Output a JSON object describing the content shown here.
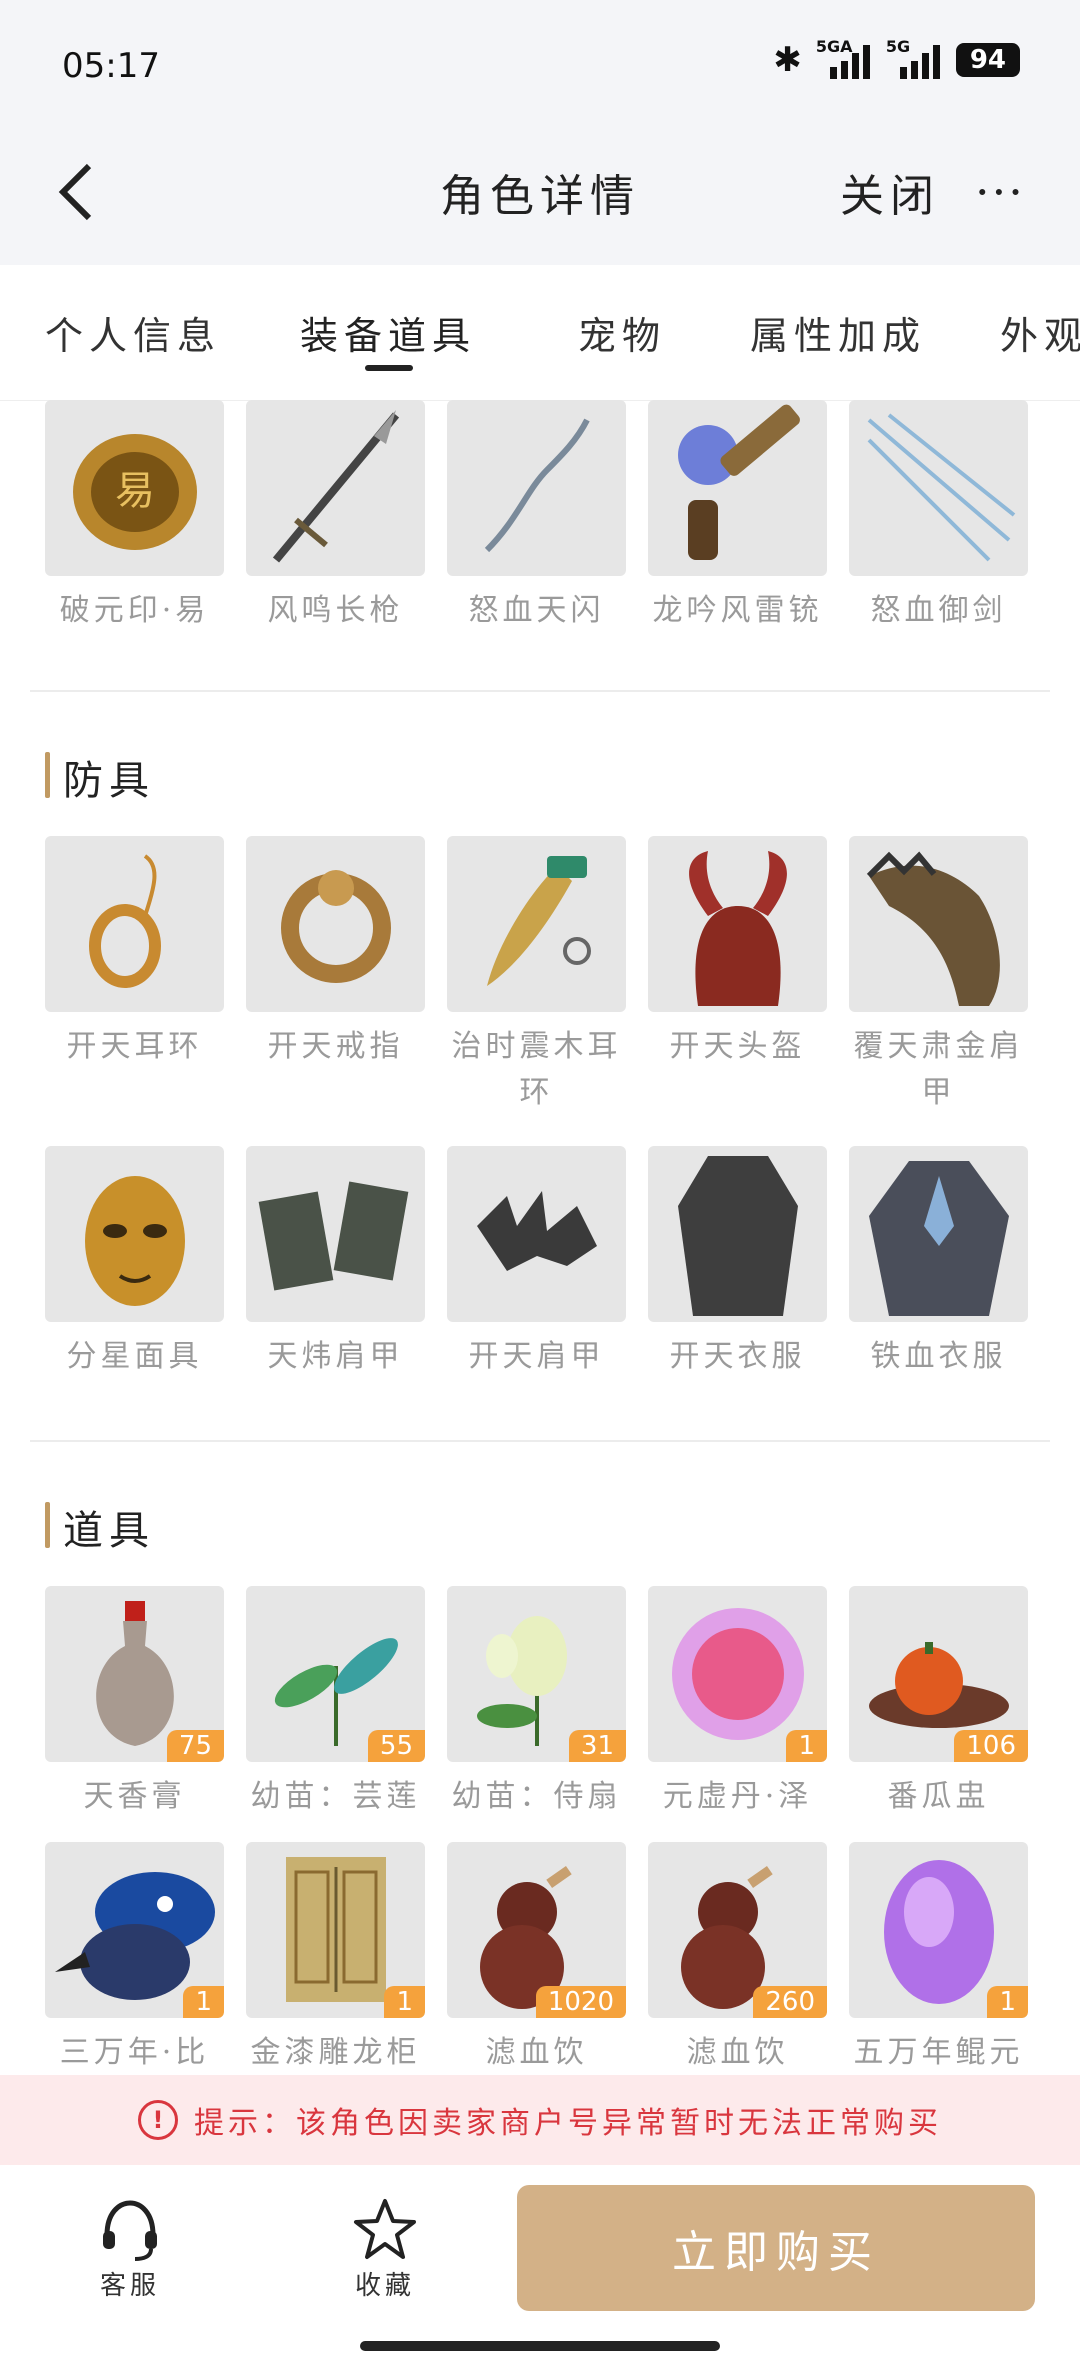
{
  "status": {
    "time": "05:17",
    "network1": "5GA",
    "network2": "5G",
    "battery": "94"
  },
  "nav": {
    "title": "角色详情",
    "close": "关闭",
    "more": "···"
  },
  "tabs": [
    "个人信息",
    "装备道具",
    "宠物",
    "属性加成",
    "外观"
  ],
  "weapons": [
    {
      "name": "破元印·易"
    },
    {
      "name": "风鸣长枪"
    },
    {
      "name": "怒血天闪"
    },
    {
      "name": "龙吟风雷铳"
    },
    {
      "name": "怒血御剑"
    }
  ],
  "armor": {
    "title": "防具",
    "row1": [
      {
        "name": "开天耳环"
      },
      {
        "name": "开天戒指"
      },
      {
        "name": "治时震木耳环"
      },
      {
        "name": "开天头盔"
      },
      {
        "name": "覆天肃金肩甲"
      }
    ],
    "row2": [
      {
        "name": "分星面具"
      },
      {
        "name": "天炜肩甲"
      },
      {
        "name": "开天肩甲"
      },
      {
        "name": "开天衣服"
      },
      {
        "name": "铁血衣服"
      }
    ]
  },
  "items": {
    "title": "道具",
    "row1": [
      {
        "name": "天香膏",
        "count": "75"
      },
      {
        "name": "幼苗：芸莲",
        "count": "55"
      },
      {
        "name": "幼苗：侍扇",
        "count": "31"
      },
      {
        "name": "元虚丹·泽",
        "count": "1"
      },
      {
        "name": "番瓜盅",
        "count": "106"
      }
    ],
    "row2": [
      {
        "name": "三万年·比",
        "count": "1"
      },
      {
        "name": "金漆雕龙柜",
        "count": "1"
      },
      {
        "name": "滤血饮",
        "count": "1020"
      },
      {
        "name": "滤血饮",
        "count": "260"
      },
      {
        "name": "五万年鲲元",
        "count": "1"
      }
    ]
  },
  "notice": "提示：该角色因卖家商户号异常暂时无法正常购买",
  "bottom": {
    "service": "客服",
    "favorite": "收藏",
    "buy": "立即购买"
  },
  "colors": {
    "accent": "#d3b187",
    "badge": "#f5a23c",
    "notice_text": "#d9363e",
    "notice_bg": "#fdeaeb"
  }
}
